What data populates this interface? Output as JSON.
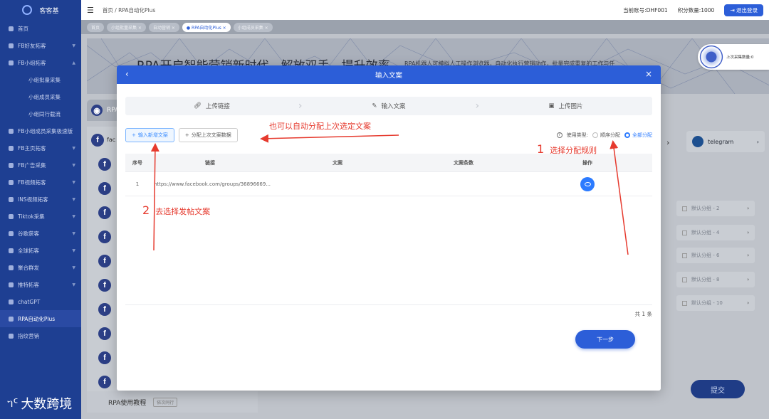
{
  "sidebar": {
    "brand": "客客基",
    "items": [
      {
        "label": "首页"
      },
      {
        "label": "FB好友拓客"
      },
      {
        "label": "FB小组拓客"
      },
      {
        "label": "小组批量采集"
      },
      {
        "label": "小组成员采集"
      },
      {
        "label": "小组同行截流"
      },
      {
        "label": "FB小组成员采集极速版"
      },
      {
        "label": "FB主页拓客"
      },
      {
        "label": "FB广告采集"
      },
      {
        "label": "FB视频拓客"
      },
      {
        "label": "INS视频拓客"
      },
      {
        "label": "Tiktok采集"
      },
      {
        "label": "谷歌获客"
      },
      {
        "label": "全球拓客"
      },
      {
        "label": "聚合群发"
      },
      {
        "label": "推特拓客"
      },
      {
        "label": "chatGPT"
      },
      {
        "label": "RPA自动化Plus"
      },
      {
        "label": "指纹营销"
      }
    ]
  },
  "topbar": {
    "breadcrumb": "首页 / RPA自动化Plus",
    "account": "当前账号:DHF001",
    "points": "积分数量:1000",
    "logout": "退出登录"
  },
  "tags": [
    {
      "label": "首页"
    },
    {
      "label": "小组批量采集 ×"
    },
    {
      "label": "自动营销 ×"
    },
    {
      "label": "● RPA自动化Plus ×"
    },
    {
      "label": "小组成员采集 ×"
    }
  ],
  "background": {
    "banner_title": "RPA开启智能营销新时代，解放双手，提升效率",
    "banner_sub": "RPA机器人可模拟人工操作浏览器，自动化执行营销动作，批量完成重复的工作与任",
    "tab_label": "RPA",
    "fb_tab_label": "fac",
    "telegram": "telegram",
    "groups": [
      "默认分组 - 2",
      "默认分组 - 4",
      "默认分组 - 6",
      "默认分组 - 8",
      "默认分组 - 10"
    ],
    "submit": "提交",
    "tutorial": "RPA使用教程",
    "tutorial_clear": "依次同行",
    "floating_label": "上次采集数量:0"
  },
  "modal": {
    "title": "输入文案",
    "steps": [
      {
        "label": "上传链接",
        "icon": "link-icon"
      },
      {
        "label": "输入文案",
        "icon": "edit-icon"
      },
      {
        "label": "上传图片",
        "icon": "image-icon"
      }
    ],
    "add_button": "输入新增文案",
    "assign_button": "分配上次文案数据",
    "use_type_label": "使用类型:",
    "use_type_options": [
      {
        "label": "顺序分配",
        "selected": false
      },
      {
        "label": "全部分配",
        "selected": true
      }
    ],
    "table": {
      "headers": [
        "序号",
        "链接",
        "文案",
        "文案条数",
        "操作"
      ],
      "rows": [
        {
          "index": "1",
          "link": "https://www.facebook.com/groups/36896669...",
          "text": "",
          "count": ""
        }
      ]
    },
    "total": "共 1 条",
    "next": "下一步"
  },
  "annotations": {
    "a1_num": "1",
    "a1_text": "选择分配规则",
    "a2_num": "2",
    "a2_text": "去选择发帖文案",
    "a3_text": "也可以自动分配上次选定文案"
  },
  "watermark": "大数跨境",
  "colors": {
    "primary": "#2c5ed8",
    "sidebar": "#1e3f92",
    "annotation": "#e63a2e"
  }
}
